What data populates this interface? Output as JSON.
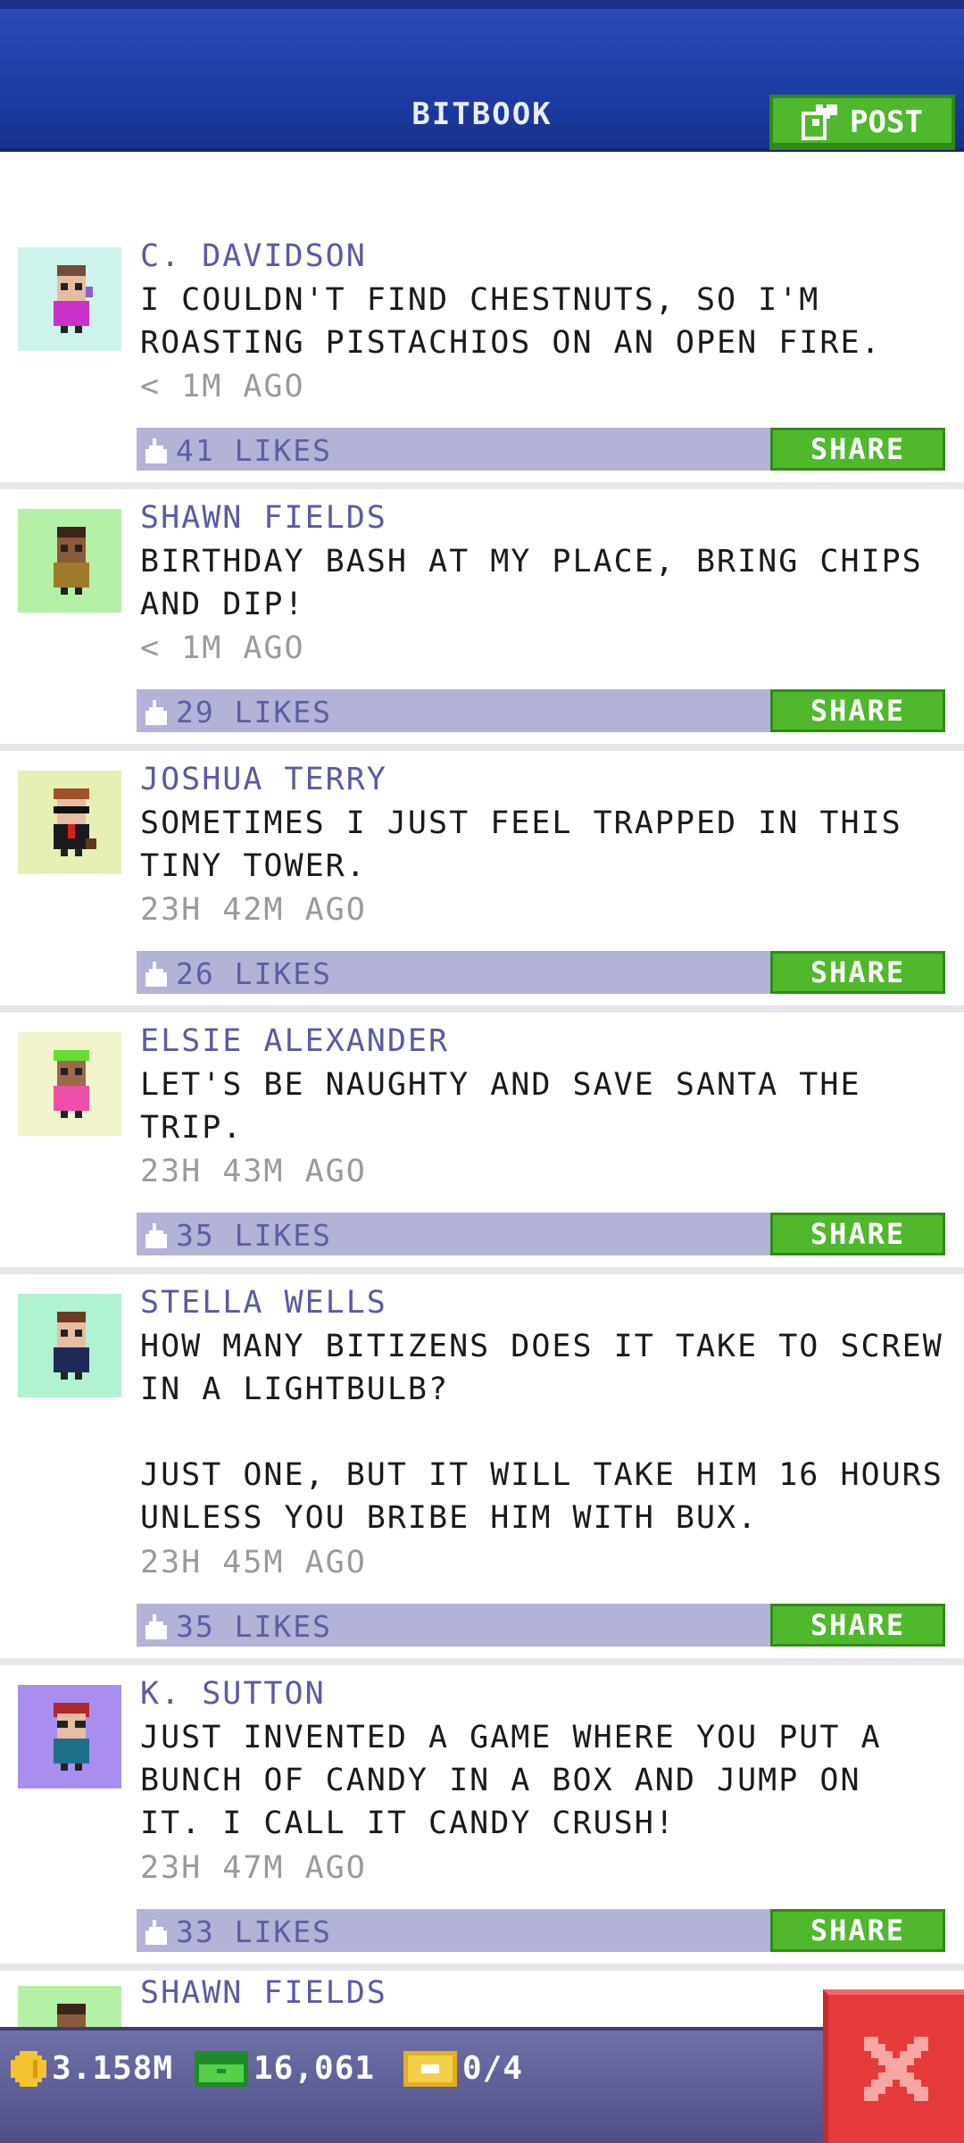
{
  "header": {
    "title": "BITBOOK",
    "post_label": "POST"
  },
  "posts": [
    {
      "name": "C. DAVIDSON",
      "text": "I COULDN'T FIND CHESTNUTS, SO I'M\nROASTING PISTACHIOS ON AN OPEN FIRE.",
      "time": "< 1M AGO",
      "likes": "41 LIKES",
      "share": "SHARE"
    },
    {
      "name": "SHAWN FIELDS",
      "text": "BIRTHDAY BASH AT MY PLACE, BRING CHIPS\nAND DIP!",
      "time": "< 1M AGO",
      "likes": "29 LIKES",
      "share": "SHARE"
    },
    {
      "name": "JOSHUA TERRY",
      "text": "SOMETIMES I JUST FEEL TRAPPED IN THIS\nTINY TOWER.",
      "time": "23H 42M AGO",
      "likes": "26 LIKES",
      "share": "SHARE"
    },
    {
      "name": "ELSIE ALEXANDER",
      "text": "LET'S BE NAUGHTY AND SAVE SANTA THE\nTRIP.",
      "time": "23H 43M AGO",
      "likes": "35 LIKES",
      "share": "SHARE"
    },
    {
      "name": "STELLA WELLS",
      "text": "HOW MANY BITIZENS DOES IT TAKE TO SCREW\nIN A LIGHTBULB?\n\nJUST ONE, BUT IT WILL TAKE HIM 16 HOURS\nUNLESS YOU BRIBE HIM WITH BUX.",
      "time": "23H 45M AGO",
      "likes": "35 LIKES",
      "share": "SHARE"
    },
    {
      "name": "K. SUTTON",
      "text": "JUST INVENTED A GAME WHERE YOU PUT A\nBUNCH OF CANDY IN A BOX AND JUMP ON\nIT. I CALL IT CANDY CRUSH!",
      "time": "23H 47M AGO",
      "likes": "33 LIKES",
      "share": "SHARE"
    }
  ],
  "partial_post": {
    "name": "SHAWN FIELDS"
  },
  "status": {
    "coins": "3.158M",
    "bux": "16,061",
    "tickets": "0/4"
  },
  "colors": {
    "header_blue": "#1d3ca4",
    "share_green": "#4fb82c",
    "likes_bar": "#b3b3d8",
    "name_purple": "#5a5aa6",
    "close_red": "#e43a3a"
  },
  "icons": {
    "post": "edit-icon",
    "like": "thumbs-up-icon",
    "coins": "coin-icon",
    "bux": "bux-icon",
    "tickets": "ticket-icon",
    "close": "close-icon"
  }
}
